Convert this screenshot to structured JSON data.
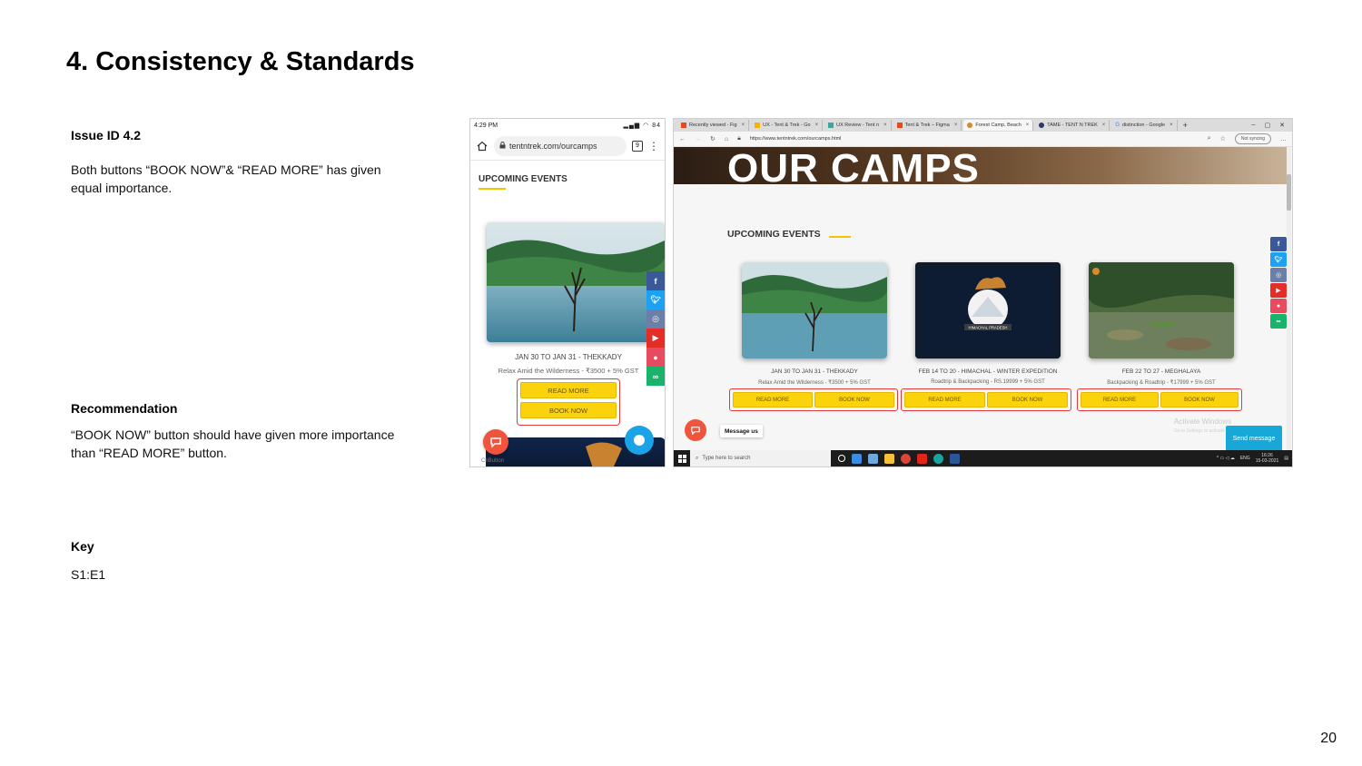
{
  "slide": {
    "title": "4. Consistency & Standards",
    "issue_label": "Issue ID 4.2",
    "issue_text": "Both buttons “BOOK NOW”& “READ MORE” has given equal importance.",
    "recommendation_label": "Recommendation",
    "recommendation_text": "“BOOK NOW” button should have given more importance than “READ MORE” button.",
    "key_label": "Key",
    "key_value": "S1:E1",
    "page_number": "20"
  },
  "mobile": {
    "time": "4:29 PM",
    "battery": "84",
    "url": "tentntrek.com/ourcamps",
    "tab_count": "9",
    "section_title": "UPCOMING EVENTS",
    "event_title": "JAN 30 TO JAN 31 - THEKKADY",
    "event_subtitle": "Relax Amid the Wilderness - ₹3500 + 5% GST",
    "read_more": "READ MORE",
    "book_now": "BOOK NOW",
    "bottom_label": "ChButton"
  },
  "desktop": {
    "tabs": [
      {
        "label": "Recently viewed - Fig"
      },
      {
        "label": "UX - Tent & Trek - Go"
      },
      {
        "label": "UX Review - Tent n"
      },
      {
        "label": "Tent & Trek – Figma"
      },
      {
        "label": "Forest Camp, Beach"
      },
      {
        "label": "TAME - TENT N TREK"
      },
      {
        "label": "distinction - Google"
      }
    ],
    "url": "https://www.tentntrek.com/ourcamps.html",
    "sync_label": "Not syncing",
    "hero_title": "OUR CAMPS",
    "section_title": "UPCOMING EVENTS",
    "events": [
      {
        "title": "JAN 30 TO JAN 31 - THEKKADY",
        "subtitle": "Relax Amid the Wilderness - ₹3500 + 5% GST",
        "read_more": "READ MORE",
        "book_now": "BOOK NOW"
      },
      {
        "title": "FEB 14 TO 20 - HIMACHAL - WINTER EXPEDITION",
        "subtitle": "Roadtrip & Backpacking - RS.19999 + 5% GST",
        "read_more": "READ MORE",
        "book_now": "BOOK NOW"
      },
      {
        "title": "FEB 22 TO 27 - MEGHALAYA",
        "subtitle": "Backpacking & Roadtrip - ₹17999 + 5% GST",
        "read_more": "READ MORE",
        "book_now": "BOOK NOW"
      }
    ],
    "badge_text": "HIMACHAL PRADESH",
    "message_us": "Message us",
    "activate_title": "Activate Windows",
    "activate_sub": "Go to Settings to activate Windows.",
    "send_message": "Send message",
    "taskbar_search": "Type here to search",
    "tray_lang": "ENG",
    "tray_time": "16:26",
    "tray_date": "15-03-2021"
  },
  "colors": {
    "button_yellow": "#fbd30c",
    "highlight_red": "#e23b3b",
    "accent_underline": "#f4c400",
    "facebook": "#3b5998",
    "twitter": "#1da1f2",
    "instagram": "#6c7fa8",
    "youtube": "#e52d27",
    "pinterest": "#e84a5f",
    "tripadvisor": "#19b36b"
  },
  "social_icons": [
    "facebook-icon",
    "twitter-icon",
    "instagram-icon",
    "youtube-icon",
    "pinterest-icon",
    "tripadvisor-icon"
  ]
}
